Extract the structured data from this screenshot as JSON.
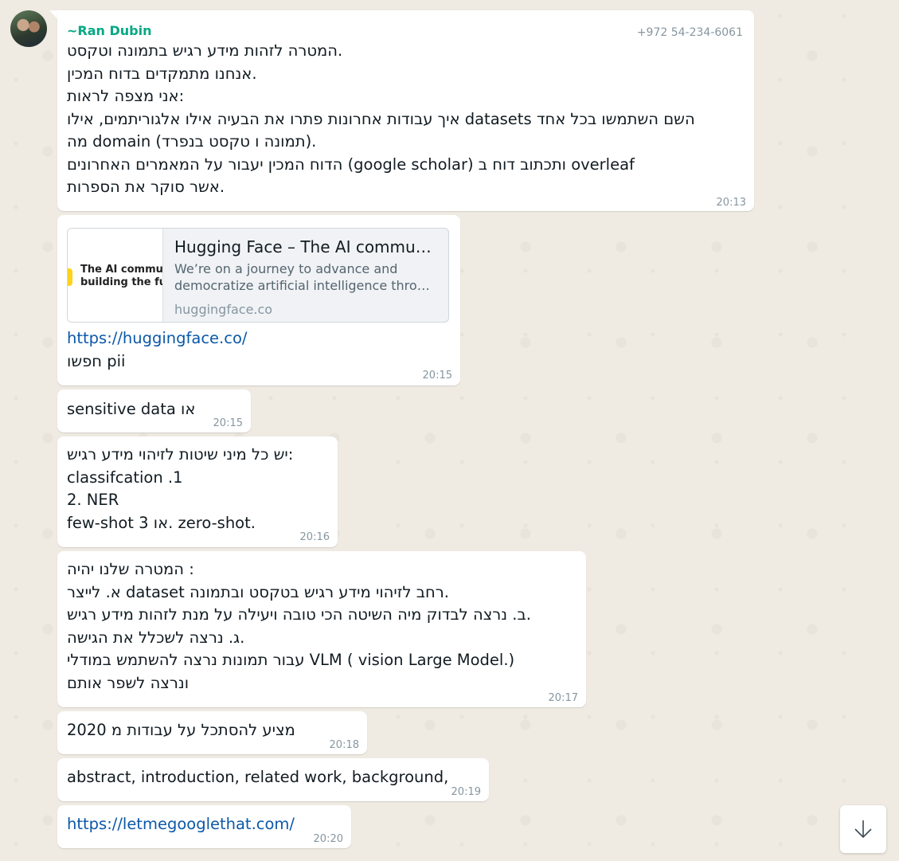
{
  "chat": {
    "sender_name": "~Ran Dubin",
    "sender_phone": "+972 54-234-6061",
    "messages": [
      {
        "time": "20:13",
        "lines": [
          "המטרה לזהות מידע רגיש בתמונה וטקסט.",
          "אנחנו מתמקדים בדוח המכין.",
          "אני מצפה לראות:",
          "איך עבודות אחרונות פתרו את הבעיה אילו אלגוריתמים, אילו datasets השם השתמשו בכל אחד",
          "מה domain (תמונה ו טקסט בנפרד).",
          "הדוח המכין יעבור על המאמרים האחרונים (google scholar)  ותכתוב דוח ב overleaf",
          "אשר סוקר את הספרות."
        ]
      },
      {
        "time": "20:15",
        "preview": {
          "title": "Hugging Face – The AI communit...",
          "description_line1": "We’re on a journey to advance and",
          "description_line2": "democratize artificial intelligence throu...",
          "domain": "huggingface.co",
          "thumbnail_text_line1": "The AI commun",
          "thumbnail_text_line2": "building the fut"
        },
        "link": "https://huggingface.co/",
        "lines": [
          "חפשו pii"
        ]
      },
      {
        "time": "20:15",
        "lines": [
          "sensitive data או"
        ]
      },
      {
        "time": "20:16",
        "lines": [
          "יש כל מיני שיטות לזיהוי מידע רגיש:",
          "classifcation .1",
          "2. NER",
          "few-shot או 3. zero-shot."
        ]
      },
      {
        "time": "20:17",
        "lines": [
          "המטרה שלנו יהיה :",
          "א. לייצר dataset רחב לזיהוי מידע רגיש בטקסט ובתמונה.",
          "ב. נרצה לבדוק מיה השיטה הכי טובה ויעילה על מנת לזהות מידע רגיש.",
          "ג. נרצה לשכלל את הגישה.",
          "עבור תמונות נרצה להשתמש במודלי VLM ( vision Large Model.)",
          "ונרצה לשפר אותם"
        ]
      },
      {
        "time": "20:18",
        "lines": [
          "מציע להסתכל על עבודות מ 2020"
        ]
      },
      {
        "time": "20:19",
        "lines": [
          "abstract, introduction, related work, background,"
        ]
      },
      {
        "time": "20:20",
        "link": "https://letmegooglethat.com/"
      }
    ]
  },
  "scroll_button_icon": "arrow-down-icon"
}
